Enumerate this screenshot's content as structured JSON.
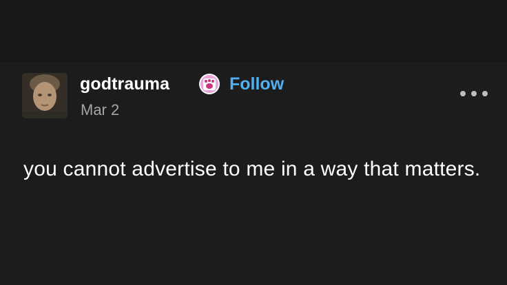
{
  "post": {
    "author": {
      "username": "godtrauma",
      "avatar_icon": "avatar-photo",
      "badge_icon": "paw-badge-icon",
      "badge_color": "#e8a3d8"
    },
    "follow_label": "Follow",
    "follow_color": "#4fb0f2",
    "date": "Mar 2",
    "more_icon": "more-horizontal-icon",
    "body": "you cannot advertise to me in a way that matters."
  }
}
